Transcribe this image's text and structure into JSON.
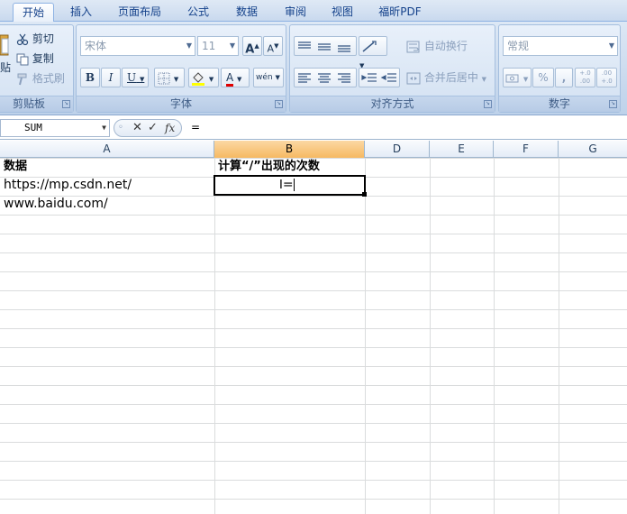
{
  "tabs": [
    "开始",
    "插入",
    "页面布局",
    "公式",
    "数据",
    "审阅",
    "视图",
    "福昕PDF"
  ],
  "active_tab": "开始",
  "clipboard": {
    "cut": "剪切",
    "copy": "复制",
    "format_painter": "格式刷",
    "paste_fragment": "贴",
    "label": "剪贴板"
  },
  "font": {
    "name": "宋体",
    "size": "11",
    "grow": "A",
    "shrink": "A",
    "bold": "B",
    "italic": "I",
    "underline": "U",
    "font_color": "A",
    "phonetic": "wén",
    "label": "字体"
  },
  "alignment": {
    "wrap_text": "自动换行",
    "merge_center": "合并后居中",
    "label": "对齐方式"
  },
  "number": {
    "format": "常规",
    "percent": "%",
    "comma": ",",
    "increase_decimal": "+.0 .00",
    "decrease_decimal": ".00 +.0",
    "label": "数字"
  },
  "formula_bar": {
    "name_box": "SUM",
    "cancel": "✕",
    "enter": "✓",
    "fx": "fx",
    "content": "="
  },
  "columns": [
    "A",
    "B",
    "D",
    "E",
    "F",
    "G"
  ],
  "selected_column": "B",
  "cells": {
    "a1": "数据",
    "b1": "计算“/”出现的次数",
    "a2": "https://mp.csdn.net/",
    "a3": "www.baidu.com/",
    "b2": "="
  },
  "colors": {
    "selected_header": "#f6b962",
    "ribbon": "#c7d8ed",
    "gridline": "#dadcdd"
  }
}
